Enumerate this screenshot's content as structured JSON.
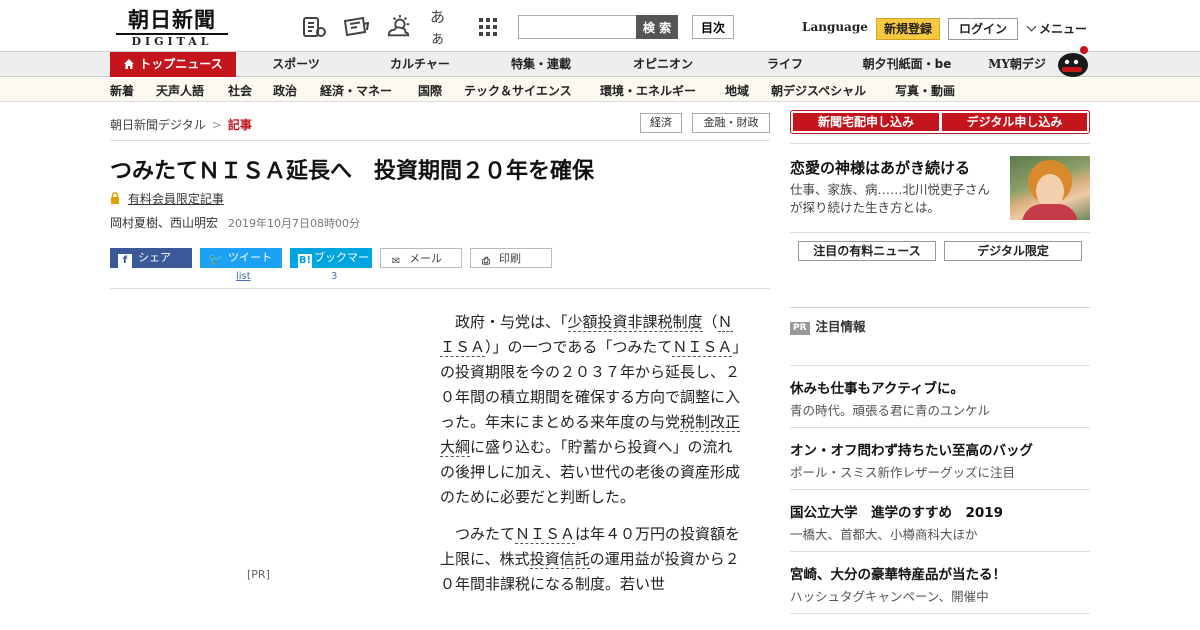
{
  "header": {
    "logo_jp": "朝日新聞",
    "logo_en": "DIGITAL",
    "search_button": "検 索",
    "search_placeholder": "",
    "toc_button": "目次",
    "language": "Language",
    "register": "新規登録",
    "login": "ログイン",
    "menu": "メニュー",
    "icons": [
      "news-list-icon",
      "paper-icon",
      "weather-icon",
      "font-size-icon",
      "grid-menu-icon"
    ],
    "font_size_glyph": "あぁ"
  },
  "main_nav": [
    {
      "label": "トップニュース",
      "active": true
    },
    {
      "label": "スポーツ"
    },
    {
      "label": "カルチャー"
    },
    {
      "label": "特集・連載"
    },
    {
      "label": "オピニオン"
    },
    {
      "label": "ライフ"
    },
    {
      "label": "朝夕刊紙面・be"
    },
    {
      "label": "MY朝デジ"
    }
  ],
  "sub_nav": [
    "新着",
    "天声人語",
    "社会",
    "政治",
    "経済・マネー",
    "国際",
    "テック＆サイエンス",
    "環境・エネルギー",
    "地域",
    "朝デジスペシャル",
    "写真・動画"
  ],
  "breadcrumb": {
    "home": "朝日新聞デジタル",
    "sep": ">",
    "current": "記事"
  },
  "tags": [
    "経済",
    "金融・財政"
  ],
  "article": {
    "headline": "つみたてＮＩＳＡ延長へ　投資期間２０年を確保",
    "premium_label": "有料会員限定記事",
    "authors": "岡村夏樹、西山明宏",
    "date": "2019年10月7日08時00分",
    "share": {
      "facebook": "シェア",
      "twitter": "ツイート",
      "twitter_count": "list",
      "hatena": "ブックマーク",
      "hatena_count": "3",
      "mail": "メール",
      "print": "印刷"
    },
    "ad_pr": "[PR]",
    "p1": {
      "a": "政府・与党は、「",
      "k1": "少額投資非課税制度",
      "b": "（",
      "k2": "ＮＩＳＡ",
      "c": "）」の一つである「つみたて",
      "k3": "ＮＩＳＡ",
      "d": "」の投資期限を今の２０３７年から延長し、２０年間の積立期間を確保する方向で調整に入った。年末にまとめる来年度の与党",
      "k4": "税制改正大綱",
      "e": "に盛り込む。「貯蓄から投資へ」の流れの後押しに加え、若い世代の老後の資産形成のために必要だと判断した。"
    },
    "p2": {
      "a": "つみたて",
      "k1": "ＮＩＳＡ",
      "b": "は年４０万円の投資額を上限に、株式",
      "k2": "投資信託",
      "c": "の運用益が投資から２０年間非課税になる制度。若い世"
    }
  },
  "right": {
    "subscribe_home": "新聞宅配申し込み",
    "subscribe_digital": "デジタル申し込み",
    "feature_title": "恋愛の神様はあがき続ける",
    "feature_desc": "仕事、家族、病……北川悦吏子さんが探り続けた生き方とは。",
    "tab_paid": "注目の有料ニュース",
    "tab_digital": "デジタル限定",
    "pr_badge": "PR",
    "pr_heading": "注目情報",
    "pr_items": [
      {
        "title": "休みも仕事もアクティブに。",
        "desc": "青の時代。頑張る君に青のユンケル"
      },
      {
        "title": "オン・オフ問わず持ちたい至高のバッグ",
        "desc": "ポール・スミス新作レザーグッズに注目"
      },
      {
        "title": "国公立大学　進学のすすめ　2019",
        "desc": "一橋大、首都大、小樽商科大ほか"
      },
      {
        "title": "宮崎、大分の豪華特産品が当たる！",
        "desc": "ハッシュタグキャンペーン、開催中"
      }
    ]
  },
  "colors": {
    "brand_red": "#c4141c",
    "register_yellow": "#f7c942",
    "facebook": "#3b5998",
    "twitter": "#1da1f2",
    "hatena": "#00a4de"
  }
}
